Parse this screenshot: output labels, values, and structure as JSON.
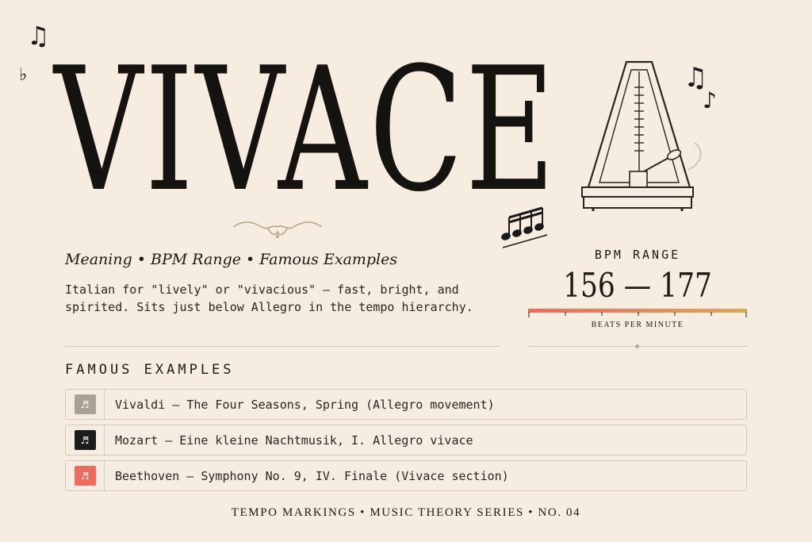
{
  "title": "VIVACE",
  "subtitle": "Meaning • BPM Range • Famous Examples",
  "description": "Italian for \"lively\" or \"vivacious\" — fast, bright, and spirited. Sits just below Allegro in the tempo hierarchy.",
  "bpm": {
    "label": "BPM RANGE",
    "value": "156 — 177",
    "caption": "BEATS PER MINUTE",
    "gradient_start": "#ee6a5a",
    "gradient_end": "#d9a95a"
  },
  "examples": {
    "heading": "FAMOUS EXAMPLES",
    "items": [
      {
        "text": "Vivaldi — The Four Seasons, Spring (Allegro movement)",
        "thumb_color": "#a9a292",
        "icon": "music-sheet-icon"
      },
      {
        "text": "Mozart — Eine kleine Nachtmusik, I. Allegro vivace",
        "thumb_color": "#1b1b1b",
        "icon": "music-sheet-icon"
      },
      {
        "text": "Beethoven — Symphony No. 9, IV. Finale (Vivace section)",
        "thumb_color": "#ec6d5d",
        "icon": "music-sheet-icon"
      }
    ]
  },
  "footer": "TEMPO MARKINGS • MUSIC THEORY SERIES • NO. 04",
  "decorations": {
    "note_symbols": [
      "♫",
      "♭",
      "♫",
      "♪"
    ]
  }
}
